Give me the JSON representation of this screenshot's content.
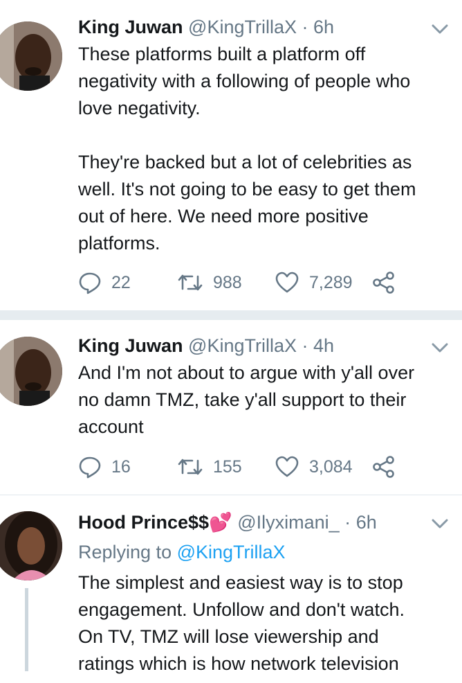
{
  "tweets": [
    {
      "name": "King Juwan",
      "handle": "@KingTrillaX",
      "dot": "·",
      "time": "6h",
      "text": "These platforms built a platform off\nnegativity with a following of people who\nlove negativity.\n\nThey're backed but a lot of celebrities as\nwell. It's not going to be easy to get them\nout of here. We need more positive\nplatforms.",
      "replies": "22",
      "retweets": "988",
      "likes": "7,289"
    },
    {
      "name": "King Juwan",
      "handle": "@KingTrillaX",
      "dot": "·",
      "time": "4h",
      "text": "And I'm not about to argue with y'all over\nno damn TMZ, take y'all support to their\naccount",
      "replies": "16",
      "retweets": "155",
      "likes": "3,084"
    },
    {
      "name": "Hood Prince$$",
      "name_emoji": "💕",
      "handle": "@Ilyximani_",
      "dot": "·",
      "time": "6h",
      "replying_prefix": "Replying to",
      "replying_to": "@KingTrillaX",
      "text": "The simplest and easiest way is to stop\nengagement. Unfollow and don't watch.\nOn TV, TMZ will lose viewership and\nratings which is how network television"
    }
  ],
  "icons": {
    "reply": "reply-icon",
    "retweet": "retweet-icon",
    "like": "heart-icon",
    "share": "share-icon",
    "more": "chevron-down-icon"
  },
  "colors": {
    "text": "#14171a",
    "muted": "#657786",
    "link": "#1da1f2",
    "divider": "#e6ecf0"
  }
}
